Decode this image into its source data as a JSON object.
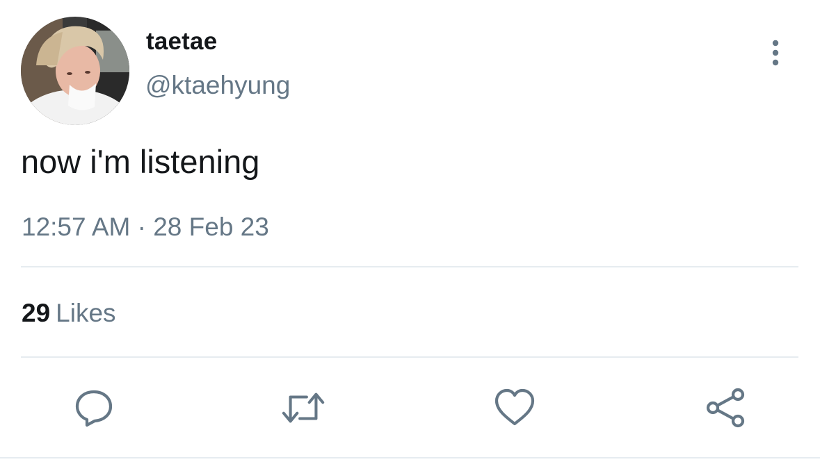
{
  "author": {
    "display_name": "taetae",
    "handle": "@ktaehyung"
  },
  "tweet": {
    "text": "now i'm listening",
    "timestamp": "12:57 AM · 28 Feb 23"
  },
  "stats": {
    "likes_count": "29",
    "likes_label": "Likes"
  },
  "icons": {
    "more": "more-vertical-icon",
    "reply": "reply-icon",
    "retweet": "retweet-icon",
    "like": "heart-icon",
    "share": "share-icon"
  },
  "colors": {
    "text_primary": "#14171a",
    "text_secondary": "#657786",
    "divider": "#e6ecf0"
  }
}
